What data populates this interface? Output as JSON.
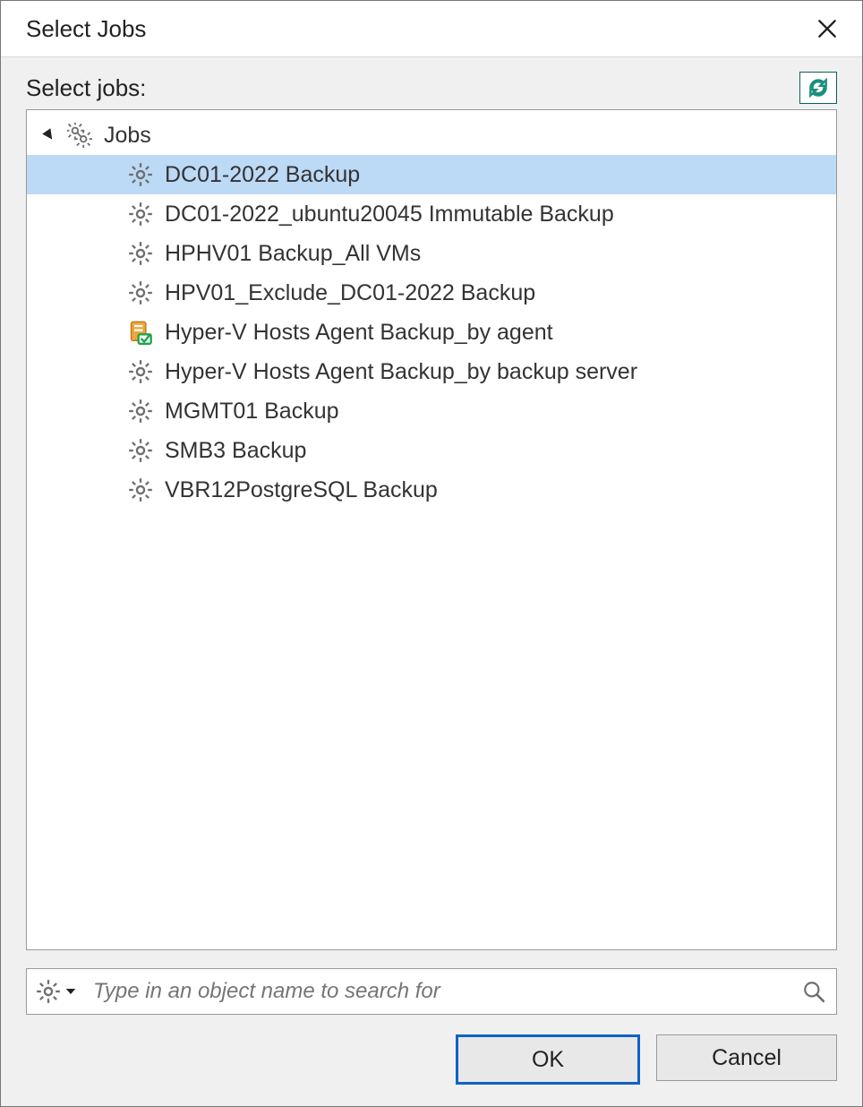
{
  "dialog": {
    "title": "Select Jobs",
    "label": "Select jobs:",
    "search_placeholder": "Type in an object name to search for",
    "buttons": {
      "ok": "OK",
      "cancel": "Cancel"
    }
  },
  "tree": {
    "root_label": "Jobs",
    "expanded": true,
    "items": [
      {
        "label": "DC01-2022 Backup",
        "icon": "gear",
        "selected": true
      },
      {
        "label": "DC01-2022_ubuntu20045 Immutable Backup",
        "icon": "gear",
        "selected": false
      },
      {
        "label": "HPHV01 Backup_All VMs",
        "icon": "gear",
        "selected": false
      },
      {
        "label": "HPV01_Exclude_DC01-2022 Backup",
        "icon": "gear",
        "selected": false
      },
      {
        "label": "Hyper-V Hosts Agent Backup_by agent",
        "icon": "agent",
        "selected": false
      },
      {
        "label": "Hyper-V Hosts Agent Backup_by backup server",
        "icon": "gear",
        "selected": false
      },
      {
        "label": "MGMT01 Backup",
        "icon": "gear",
        "selected": false
      },
      {
        "label": "SMB3 Backup",
        "icon": "gear",
        "selected": false
      },
      {
        "label": "VBR12PostgreSQL Backup",
        "icon": "gear",
        "selected": false
      }
    ]
  },
  "icons": {
    "close": "close-icon",
    "refresh": "refresh-icon",
    "search": "search-icon",
    "filter_chevron": "chevron-down-icon"
  }
}
